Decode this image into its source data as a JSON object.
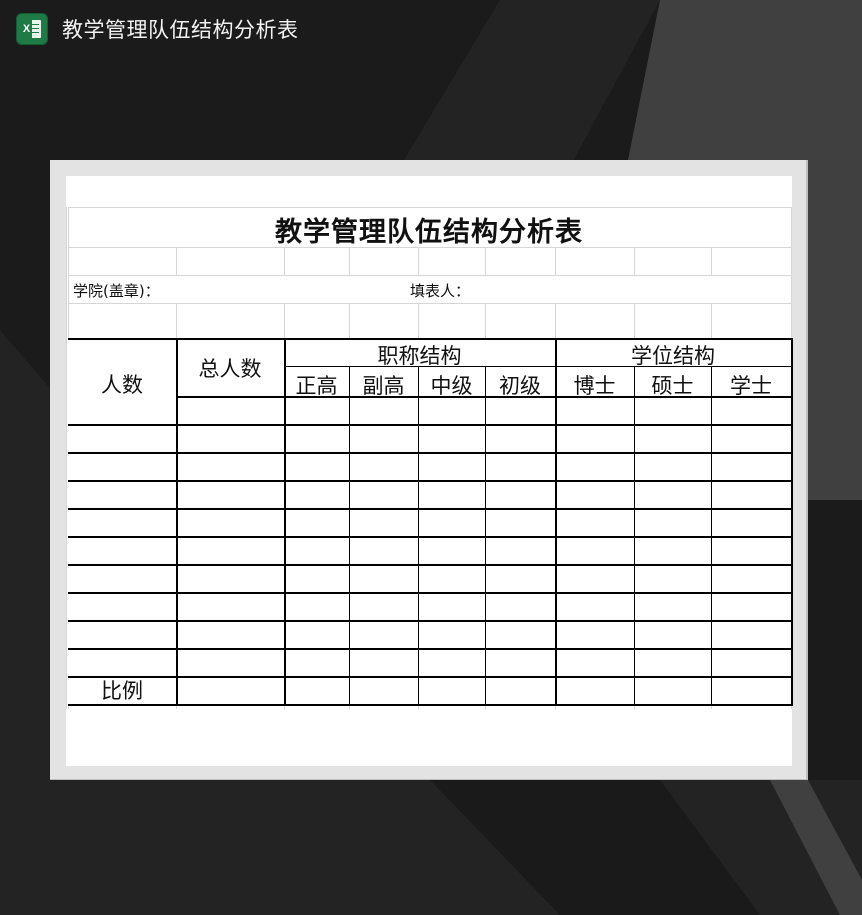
{
  "window": {
    "app_icon": "excel-icon",
    "title": "教学管理队伍结构分析表"
  },
  "colors": {
    "background_dark": "#1b1b1b",
    "background_mid": "#242424",
    "background_light": "#404040",
    "frame": "#e3e3e3",
    "excel_green": "#1e7b45",
    "grid_line": "#d6d6d6",
    "table_border": "#000000"
  },
  "sheet": {
    "title": "教学管理队伍结构分析表",
    "college_label": "学院(盖章)：",
    "filler_label": "填表人：",
    "table": {
      "row_header": "人数",
      "total_header": "总人数",
      "groups": [
        {
          "label": "职称结构",
          "columns": [
            "正高",
            "副高",
            "中级",
            "初级"
          ]
        },
        {
          "label": "学位结构",
          "columns": [
            "博士",
            "硕士",
            "学士"
          ]
        }
      ],
      "data_rows": [
        {
          "label": "",
          "cells": [
            "",
            "",
            "",
            "",
            "",
            "",
            "",
            ""
          ]
        },
        {
          "label": "",
          "cells": [
            "",
            "",
            "",
            "",
            "",
            "",
            "",
            ""
          ]
        },
        {
          "label": "",
          "cells": [
            "",
            "",
            "",
            "",
            "",
            "",
            "",
            ""
          ]
        },
        {
          "label": "",
          "cells": [
            "",
            "",
            "",
            "",
            "",
            "",
            "",
            ""
          ]
        },
        {
          "label": "",
          "cells": [
            "",
            "",
            "",
            "",
            "",
            "",
            "",
            ""
          ]
        },
        {
          "label": "",
          "cells": [
            "",
            "",
            "",
            "",
            "",
            "",
            "",
            ""
          ]
        },
        {
          "label": "",
          "cells": [
            "",
            "",
            "",
            "",
            "",
            "",
            "",
            ""
          ]
        },
        {
          "label": "",
          "cells": [
            "",
            "",
            "",
            "",
            "",
            "",
            "",
            ""
          ]
        },
        {
          "label": "",
          "cells": [
            "",
            "",
            "",
            "",
            "",
            "",
            "",
            ""
          ]
        },
        {
          "label": "",
          "cells": [
            "",
            "",
            "",
            "",
            "",
            "",
            "",
            ""
          ]
        },
        {
          "label": "比例",
          "cells": [
            "",
            "",
            "",
            "",
            "",
            "",
            "",
            ""
          ]
        }
      ]
    }
  }
}
